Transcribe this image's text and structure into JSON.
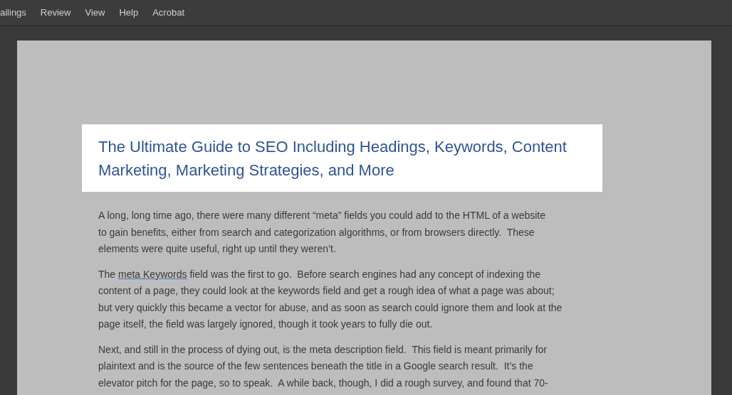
{
  "menu": [
    {
      "label": "ailings"
    },
    {
      "label": "Review"
    },
    {
      "label": "View"
    },
    {
      "label": "Help"
    },
    {
      "label": "Acrobat"
    }
  ],
  "document": {
    "title_lines": [
      "The Ultimate Guide to SEO Including Headings, Keywords, Content",
      "Marketing, Marketing Strategies, and More"
    ],
    "paragraphs": [
      {
        "lines": [
          [
            {
              "text": "A long, long time ago, there were many different “meta” fields you could add to the HTML of a website"
            }
          ],
          [
            {
              "text": "to gain benefits, either from search and categorization algorithms, or from browsers directly.  These"
            }
          ],
          [
            {
              "text": "elements were quite useful, right up until they weren’t."
            }
          ]
        ]
      },
      {
        "lines": [
          [
            {
              "text": "The "
            },
            {
              "text": "meta Keywords",
              "kind": "link"
            },
            {
              "text": " field was the first to go.  Before search engines had any concept of indexing the"
            }
          ],
          [
            {
              "text": "content of a page, they could look at the keywords field and get a rough idea of what a page was about;"
            }
          ],
          [
            {
              "text": "but very quickly this became a vector for abuse, and as soon as search could ignore them and look at the"
            }
          ],
          [
            {
              "text": "page itself, the field was largely ignored, though it took years to fully die out."
            }
          ]
        ]
      },
      {
        "lines": [
          [
            {
              "text": "Next, and still in the process of dying out, is the meta description field.  This field is meant primarily for"
            }
          ],
          [
            {
              "text": "plaintext and is the source of the few sentences beneath the title in a Google search result.  It’s the"
            }
          ],
          [
            {
              "text": "elevator pitch for the page, so to speak.  A while back, though, I did a rough survey, and found that 70-"
            }
          ]
        ]
      }
    ]
  }
}
